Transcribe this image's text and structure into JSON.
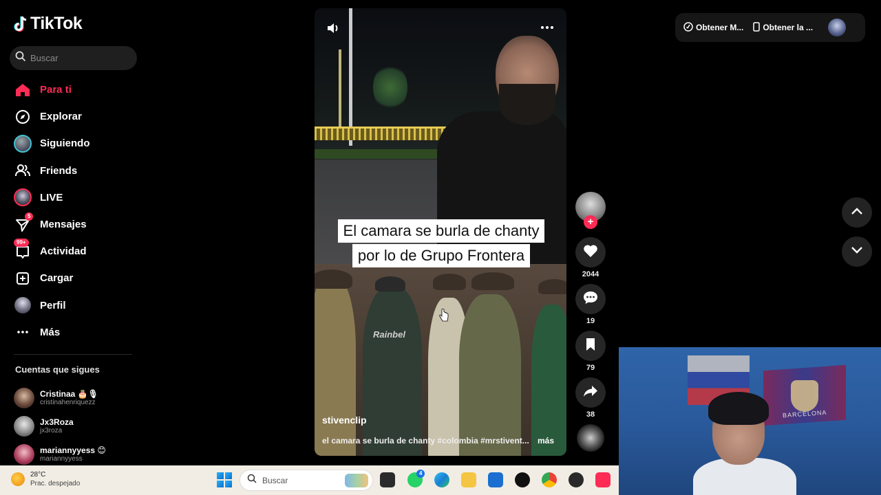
{
  "brand": {
    "name": "TikTok"
  },
  "search": {
    "placeholder": "Buscar"
  },
  "nav": {
    "items": [
      {
        "label": "Para ti",
        "icon": "home-icon",
        "active": true
      },
      {
        "label": "Explorar",
        "icon": "compass-icon"
      },
      {
        "label": "Siguiendo",
        "icon": "following-avatar"
      },
      {
        "label": "Friends",
        "icon": "friends-icon"
      },
      {
        "label": "LIVE",
        "icon": "live-avatar"
      },
      {
        "label": "Mensajes",
        "icon": "messages-icon",
        "badge": "5"
      },
      {
        "label": "Actividad",
        "icon": "activity-icon",
        "badge": "99+"
      },
      {
        "label": "Cargar",
        "icon": "upload-icon"
      },
      {
        "label": "Perfil",
        "icon": "profile-avatar"
      },
      {
        "label": "Más",
        "icon": "more-icon"
      }
    ]
  },
  "following": {
    "title": "Cuentas que sigues",
    "accounts": [
      {
        "name": "Cristinaa 🎂🎙",
        "handle": "cristinahenriquezz"
      },
      {
        "name": "Jx3Roza",
        "handle": "jx3roza"
      },
      {
        "name": "mariannyyess 😊",
        "handle": "mariannyyess"
      }
    ]
  },
  "video": {
    "caption_line1": "El camara se burla de chanty",
    "caption_line2": "por lo de Grupo Frontera",
    "author": "stivenclip",
    "description": "el camara se burla de chanty #colombia #mrstivent...",
    "more_label": "más",
    "rack_label": "Rainbel"
  },
  "actions": {
    "likes": "2044",
    "comments": "19",
    "saves": "79",
    "shares": "38"
  },
  "topbar": {
    "get_app_1": "Obtener M...",
    "get_app_2": "Obtener la ..."
  },
  "taskbar": {
    "weather_temp": "28°C",
    "weather_desc": "Prac. despejado",
    "search_label": "Buscar",
    "whatsapp_badge": "4"
  },
  "webcam": {
    "banner_text": "BARCELONA"
  },
  "colors": {
    "accent": "#fe2c55",
    "live_ring": "#40c4d0",
    "sidebar_bg": "#000000"
  }
}
